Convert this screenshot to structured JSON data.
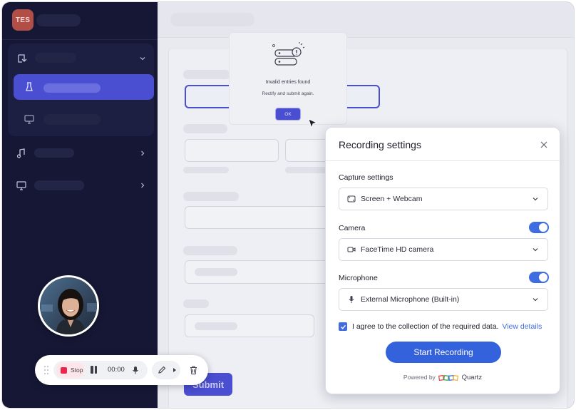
{
  "sidebar": {
    "avatar_initials": "TES"
  },
  "modal": {
    "title": "Invalid entries found",
    "message": "Rectify and submit again.",
    "ok_label": "OK"
  },
  "form": {
    "submit_label": "Submit"
  },
  "recorder": {
    "stop_label": "Stop",
    "timer": "00:00"
  },
  "settings": {
    "title": "Recording settings",
    "capture": {
      "label": "Capture settings",
      "value": "Screen + Webcam",
      "icon": "screen-webcam-icon"
    },
    "camera": {
      "label": "Camera",
      "enabled": true,
      "value": "FaceTime HD camera",
      "icon": "video-camera-icon"
    },
    "microphone": {
      "label": "Microphone",
      "enabled": true,
      "value": "External Microphone (Built-in)",
      "icon": "microphone-icon"
    },
    "consent": {
      "checked": true,
      "text": "I agree to the collection of the required data.",
      "link": "View details"
    },
    "start_label": "Start Recording",
    "powered_by": "Powered by",
    "brand": "Quartz"
  },
  "colors": {
    "sidebar_bg": "#161735",
    "accent": "#4a4ed0",
    "primary_button": "#3462dc",
    "stop_red": "#e8264f"
  }
}
